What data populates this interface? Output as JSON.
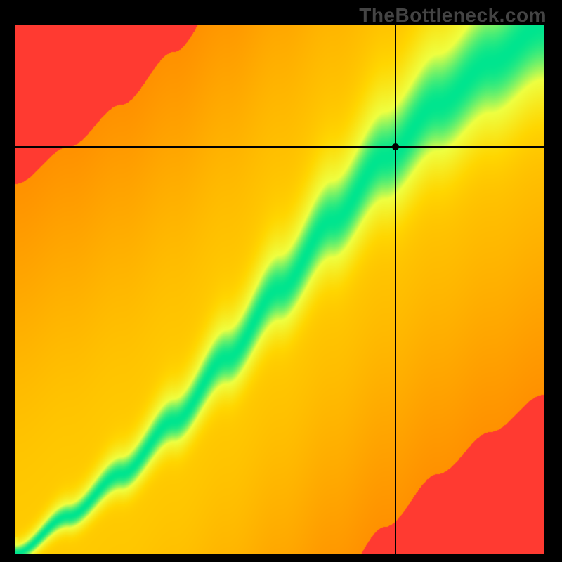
{
  "watermark": "TheBottleneck.com",
  "chart_data": {
    "type": "heatmap",
    "title": "",
    "xlabel": "",
    "ylabel": "",
    "xlim": [
      0,
      1
    ],
    "ylim": [
      0,
      1
    ],
    "crosshair": {
      "x": 0.72,
      "y": 0.77
    },
    "ridge_points": [
      {
        "x": 0.0,
        "y": 0.0
      },
      {
        "x": 0.1,
        "y": 0.07
      },
      {
        "x": 0.2,
        "y": 0.15
      },
      {
        "x": 0.3,
        "y": 0.25
      },
      {
        "x": 0.4,
        "y": 0.37
      },
      {
        "x": 0.5,
        "y": 0.5
      },
      {
        "x": 0.6,
        "y": 0.63
      },
      {
        "x": 0.7,
        "y": 0.75
      },
      {
        "x": 0.8,
        "y": 0.85
      },
      {
        "x": 0.9,
        "y": 0.93
      },
      {
        "x": 1.0,
        "y": 1.0
      }
    ],
    "color_stops": [
      {
        "t": 0.0,
        "color": "#ff1744"
      },
      {
        "t": 0.35,
        "color": "#ff9100"
      },
      {
        "t": 0.65,
        "color": "#ffd600"
      },
      {
        "t": 0.85,
        "color": "#eeff41"
      },
      {
        "t": 1.0,
        "color": "#00e58e"
      }
    ]
  }
}
